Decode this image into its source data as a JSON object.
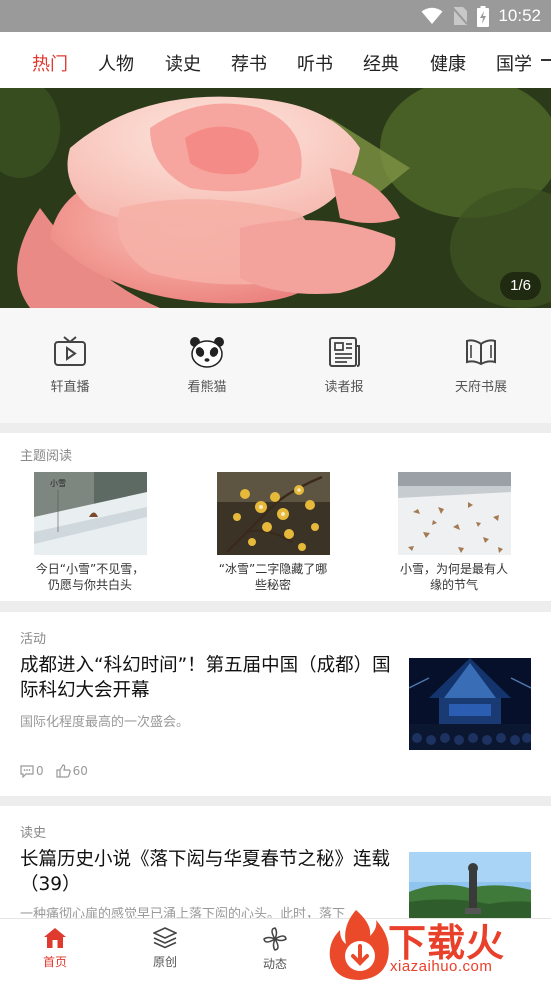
{
  "status_bar": {
    "time": "10:52"
  },
  "categories": [
    "热门",
    "人物",
    "读史",
    "荐书",
    "听书",
    "经典",
    "健康",
    "国学"
  ],
  "active_category": "热门",
  "banner": {
    "pager": "1/6"
  },
  "quick_entries": [
    {
      "label": "轩直播",
      "icon": "tv-icon"
    },
    {
      "label": "看熊猫",
      "icon": "panda-icon"
    },
    {
      "label": "读者报",
      "icon": "newspaper-icon"
    },
    {
      "label": "天府书展",
      "icon": "book-icon"
    }
  ],
  "theme_reading": {
    "section_title": "主题阅读",
    "cards": [
      {
        "caption": "今日“小雪”不见雪，仍愿与你共白头",
        "image_text": "小雪"
      },
      {
        "caption": "“冰雪”二字隐藏了哪些秘密"
      },
      {
        "caption": "小雪，为何是最有人缘的节气"
      }
    ]
  },
  "articles": [
    {
      "section": "活动",
      "title": "成都进入“科幻时间”！第五届中国（成都）国际科幻大会开幕",
      "desc": "国际化程度最高的一次盛会。",
      "comments": "0",
      "likes": "60"
    },
    {
      "section": "读史",
      "title": "长篇历史小说《落下闳与华夏春节之秘》连载（39）",
      "desc": "一种痛彻心扉的感觉早已涌上落下闳的心头。此时，落下"
    }
  ],
  "bottom_nav": [
    {
      "label": "首页",
      "icon": "home-icon",
      "active": true
    },
    {
      "label": "原创",
      "icon": "layers-icon",
      "active": false
    },
    {
      "label": "动态",
      "icon": "pinwheel-icon",
      "active": false
    }
  ],
  "watermark": {
    "title": "下载火",
    "url": "xiazaihuo.com"
  },
  "colors": {
    "accent": "#e03a2f",
    "watermark": "#e8402a"
  }
}
